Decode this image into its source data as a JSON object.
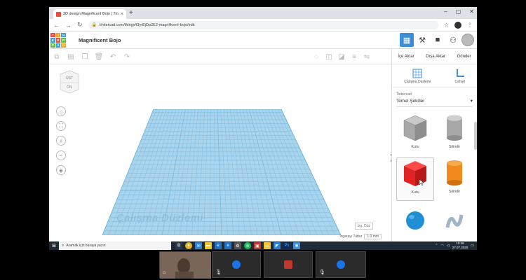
{
  "browser": {
    "tab_title": "3D design Magnificent Bojo | Tin",
    "tab_close": "×",
    "new_tab": "+",
    "url": "tinkercad.com/things/f3yrEjDp2E2-magnificent-bojo/edit",
    "win_min": "–",
    "win_max": "▢",
    "win_close": "✕"
  },
  "tinkercad": {
    "logo_letters": [
      "TIN",
      "KER",
      "CAD"
    ],
    "project_name": "Magnificent Bojo",
    "header_icons": [
      "grid-icon",
      "pickaxe-icon",
      "suitcase-icon",
      "add-user-icon"
    ],
    "import_label": "İçe Aktar",
    "export_label": "Dışa Aktar",
    "send_label": "Gönder",
    "viewcube_top": "ÜST",
    "viewcube_front": "ÖN",
    "workplane_text": "Çalışma Düzlemi",
    "edit_grid": "Izg. Düz",
    "snap_label": "Izgarayı Tuttur",
    "snap_value": "1.0 mm"
  },
  "right_panel": {
    "workplane_btn": "Çalışma Düzlemi",
    "ruler_btn": "Cetvel",
    "library_label": "Tinkercad",
    "library_selected": "Temel Şekiller",
    "shapes": [
      {
        "name": "Kutu"
      },
      {
        "name": "Silindir"
      },
      {
        "name": "Kutu"
      },
      {
        "name": "Silindir"
      }
    ]
  },
  "taskbar": {
    "search_placeholder": "Aramak için buraya yazın",
    "time": "10:46",
    "date": "27.07.2020"
  },
  "colors": {
    "grid_fill": "#a9d4ec",
    "grid_line": "#6fb5de",
    "accent": "#3c8fd6",
    "box_gray": "#a8a8a8",
    "box_red": "#e02424",
    "cyl_orange": "#f08a1c",
    "sphere_blue": "#1f8fd6",
    "taskbar": "#1f2a36"
  }
}
